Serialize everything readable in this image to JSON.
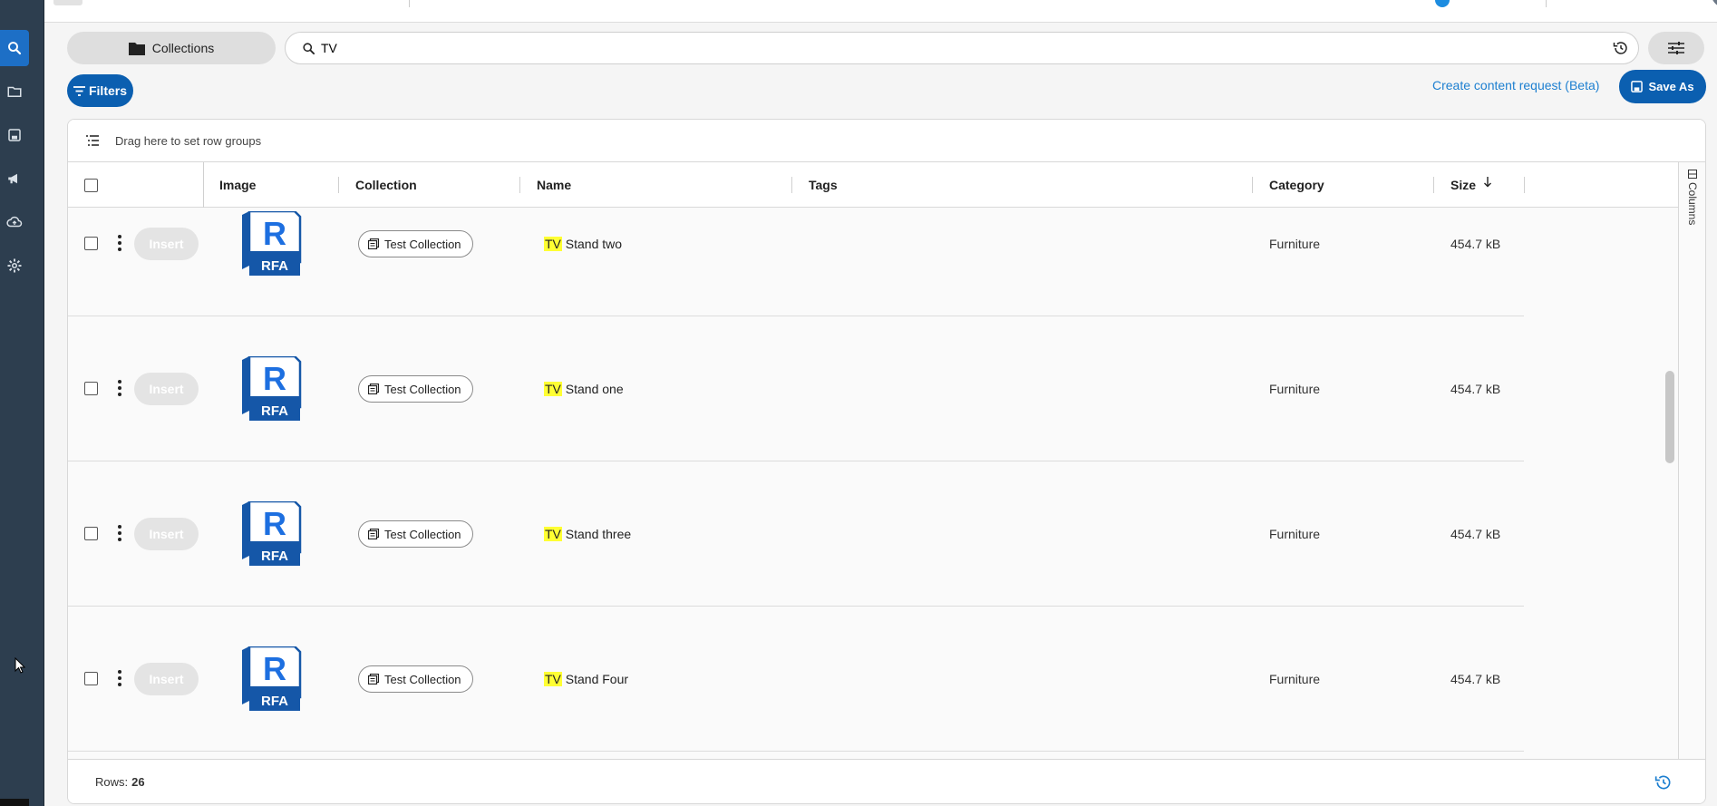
{
  "sidebar": {
    "items": [
      {
        "icon": "search-icon",
        "active": true
      },
      {
        "icon": "folder-icon",
        "active": false
      },
      {
        "icon": "save-icon",
        "active": false
      },
      {
        "icon": "megaphone-icon",
        "active": false
      },
      {
        "icon": "cloud-upload-icon",
        "active": false
      },
      {
        "icon": "gear-icon",
        "active": false
      }
    ]
  },
  "toolbar": {
    "collections_label": "Collections",
    "search_value": "TV",
    "filters_label": "Filters",
    "content_request_label": "Create content request (Beta)",
    "save_as_label": "Save As"
  },
  "grid": {
    "rowgroup_hint": "Drag here to set row groups",
    "columns": [
      "Image",
      "Collection",
      "Name",
      "Tags",
      "Category",
      "Size"
    ],
    "sort_column": "Size",
    "sort_direction": "descending",
    "columns_panel_label": "Columns",
    "insert_label": "Insert",
    "image_badge_letter": "R",
    "image_badge_label": "RFA",
    "rows": [
      {
        "collection": "Test Collection",
        "name_highlight": "TV",
        "name_rest": " Stand two",
        "tags": "",
        "category": "Furniture",
        "size": "454.7 kB"
      },
      {
        "collection": "Test Collection",
        "name_highlight": "TV",
        "name_rest": " Stand one",
        "tags": "",
        "category": "Furniture",
        "size": "454.7 kB"
      },
      {
        "collection": "Test Collection",
        "name_highlight": "TV",
        "name_rest": " Stand three",
        "tags": "",
        "category": "Furniture",
        "size": "454.7 kB"
      },
      {
        "collection": "Test Collection",
        "name_highlight": "TV",
        "name_rest": " Stand Four",
        "tags": "",
        "category": "Furniture",
        "size": "454.7 kB"
      }
    ],
    "footer": {
      "rows_label": "Rows:",
      "rows_count": "26"
    }
  },
  "colors": {
    "sidebar": "#2d3e4f",
    "primary": "#0b5fb0",
    "link": "#1d7fd0",
    "highlight": "#ffff33",
    "rfa_blue": "#1557a8"
  }
}
